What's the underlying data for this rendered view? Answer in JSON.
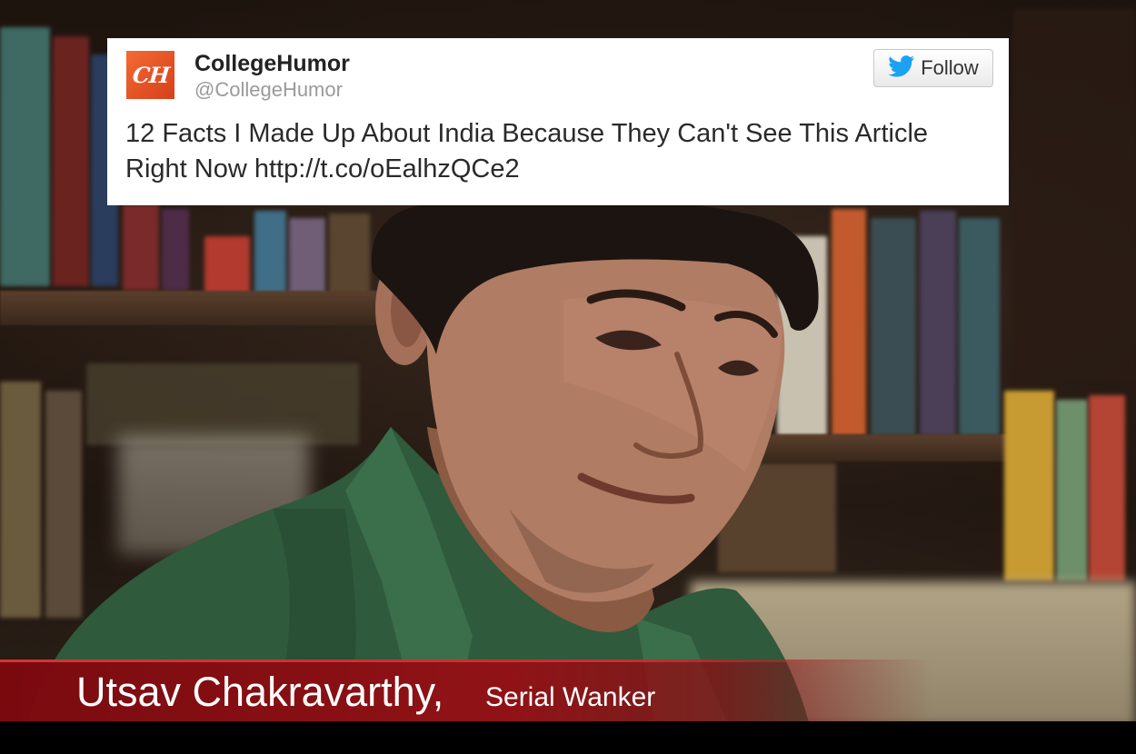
{
  "tweet": {
    "avatar_text": "CH",
    "display_name": "CollegeHumor",
    "handle": "@CollegeHumor",
    "follow_label": "Follow",
    "follow_icon": "twitter-bird-icon",
    "text": "12 Facts I Made Up About India Because They Can't See This Article Right Now http://t.co/oEalhzQCe2",
    "brand_color": "#e6502a",
    "bird_color": "#1da1f2"
  },
  "lower_third": {
    "name": "Utsav Chakravarthy,",
    "title": "Serial Wanker",
    "bar_color": "#8c0d12"
  }
}
